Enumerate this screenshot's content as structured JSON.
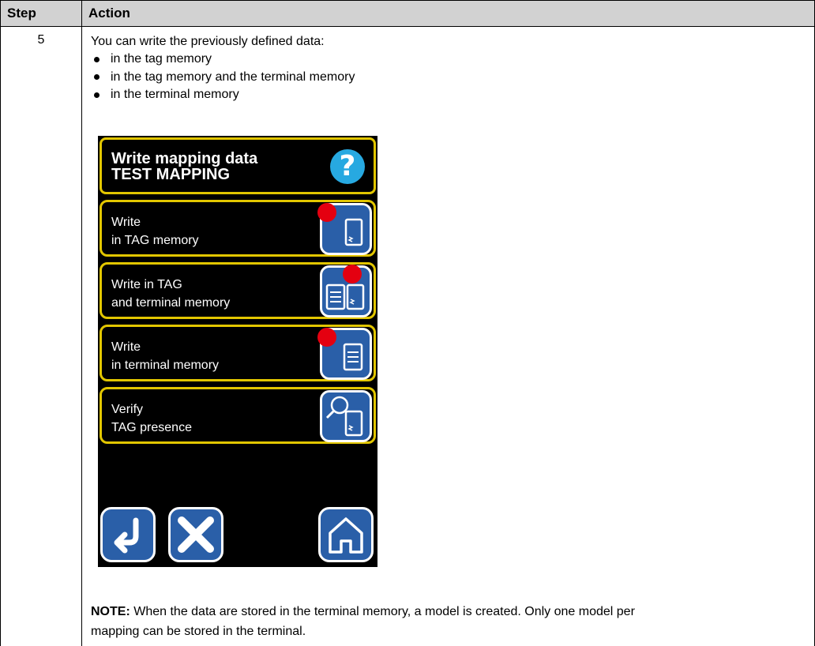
{
  "table": {
    "header_step": "Step",
    "header_action": "Action",
    "step_number": "5",
    "intro": "You can write the previously defined data:",
    "bullets": [
      "in the tag memory",
      "in the tag memory and the terminal memory",
      "in the terminal memory"
    ],
    "note_label": "NOTE:",
    "note_line1": " When the data are stored in the terminal memory, a model is created. Only one model per",
    "note_line2": "mapping can be stored in the terminal."
  },
  "device": {
    "title_line1": "Write mapping data",
    "title_line2": "TEST MAPPING",
    "help_glyph": "?",
    "options": [
      {
        "line1": "Write",
        "line2": "in TAG memory",
        "icon": "tag-write-icon"
      },
      {
        "line1": "Write in TAG",
        "line2": "and terminal memory",
        "icon": "tag-and-terminal-write-icon"
      },
      {
        "line1": "Write",
        "line2": "in terminal memory",
        "icon": "terminal-write-icon"
      },
      {
        "line1": "Verify",
        "line2": "TAG presence",
        "icon": "verify-tag-icon"
      }
    ],
    "bottom_buttons": [
      "back-icon",
      "cancel-icon",
      "home-icon"
    ],
    "colors": {
      "screen": "#000000",
      "frame": "#e2c600",
      "button": "#2a5fa8",
      "help": "#27a9e1",
      "record_dot": "#e40010"
    }
  }
}
